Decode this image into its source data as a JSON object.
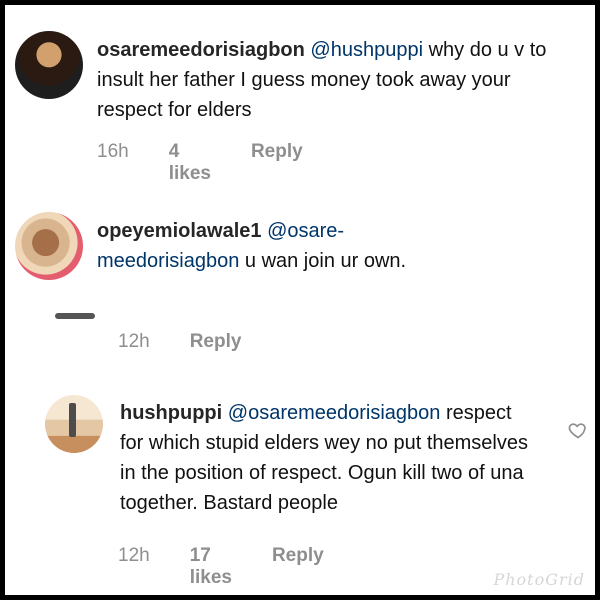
{
  "comments": [
    {
      "username": "osaremeedorisiagbon",
      "mention": "@hushpuppi",
      "text": " why do u v to insult her father I guess money took away your respect for elders",
      "time": "16h",
      "likes": "4 likes",
      "reply_label": "Reply",
      "avatar_icon": "user-avatar"
    },
    {
      "username": "opeyemiolawale1",
      "mention": "@osare-meedorisiagbon",
      "text": " u wan join ur own.",
      "time": "12h",
      "reply_label": "Reply",
      "avatar_icon": "user-avatar"
    },
    {
      "username": "hushpuppi",
      "mention": "@osaremeedorisiagbon",
      "text": " respect for which stupid elders wey no put themselves in the position of respect. Ogun kill two of una together. Bastard people",
      "time": "12h",
      "likes": "17 likes",
      "reply_label": "Reply",
      "avatar_icon": "user-avatar",
      "like_icon": "heart-outline"
    }
  ],
  "watermark": "PhotoGrid",
  "colors": {
    "username": "#262626",
    "mention": "#003569",
    "meta": "#8e8e8e",
    "background": "#ffffff",
    "border": "#000000"
  }
}
